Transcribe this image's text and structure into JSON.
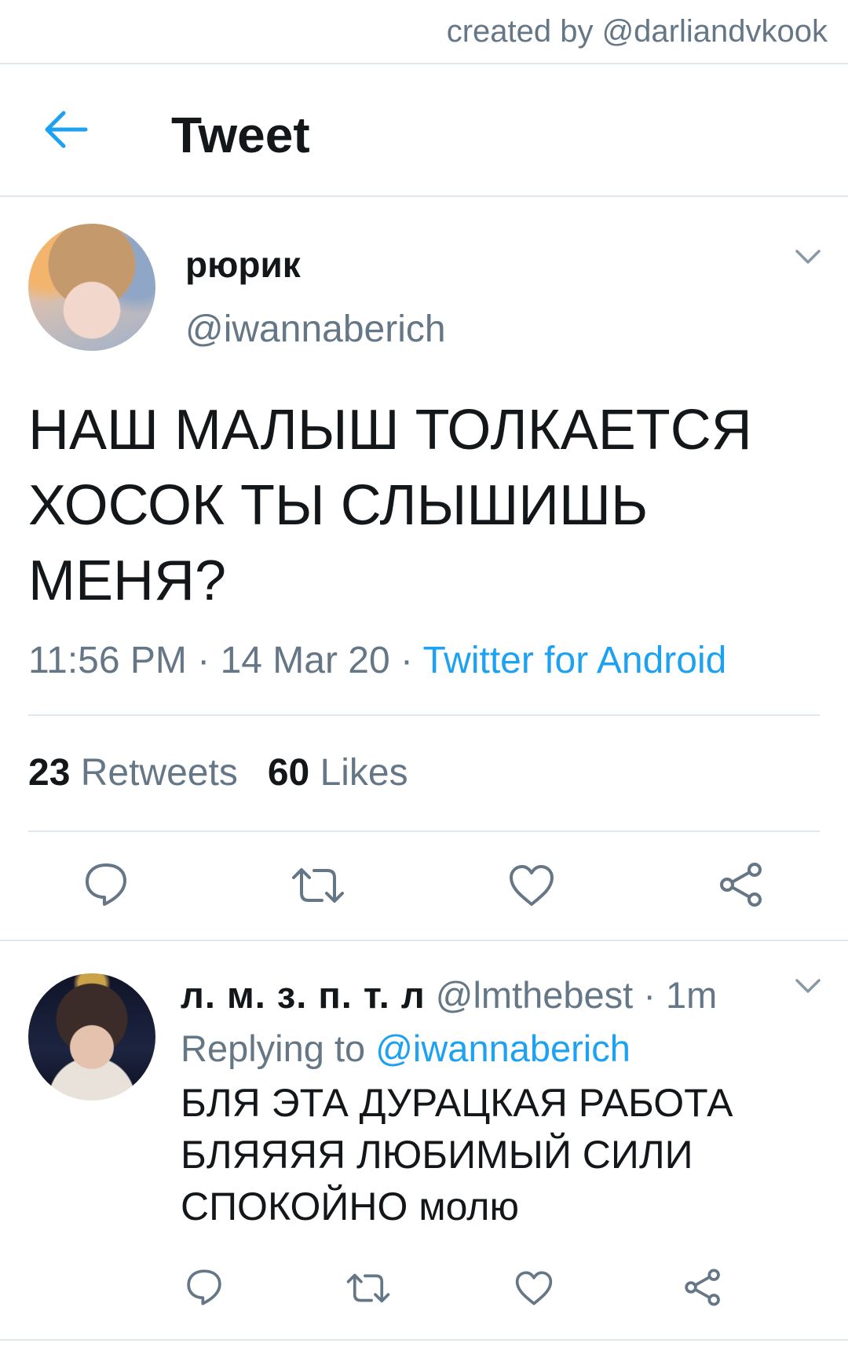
{
  "credit": "created by @darliandvkook",
  "header": {
    "title": "Tweet",
    "back_icon": "arrow-left-icon"
  },
  "colors": {
    "accent": "#1da1f2",
    "secondary_text": "#657786",
    "divider": "#e1e8ed",
    "primary_text": "#14171a"
  },
  "tweet": {
    "display_name": "рюрик",
    "handle": "@iwannaberich",
    "text": "НАШ МАЛЫШ ТОЛКАЕТСЯ\nХОСОК ТЫ СЛЫШИШЬ\nМЕНЯ?",
    "time": "11:56 PM",
    "date": "14 Mar 20",
    "separator": "·",
    "source": "Twitter for Android",
    "retweets_count": "23",
    "retweets_label": "Retweets",
    "likes_count": "60",
    "likes_label": "Likes",
    "actions": [
      "reply-icon",
      "retweet-icon",
      "like-icon",
      "share-icon"
    ]
  },
  "reply": {
    "display_name": "л. м. з. п. т. л",
    "handle": "@lmthebest",
    "separator": "·",
    "time_ago": "1m",
    "replying_to_label": "Replying to",
    "replying_to_handle": "@iwannaberich",
    "text": "БЛЯ ЭТА ДУРАЦКАЯ РАБОТА\nБЛЯЯЯЯ ЛЮБИМЫЙ СИЛИ\nСПОКОЙНО молю",
    "actions": [
      "reply-icon",
      "retweet-icon",
      "like-icon",
      "share-icon"
    ]
  }
}
